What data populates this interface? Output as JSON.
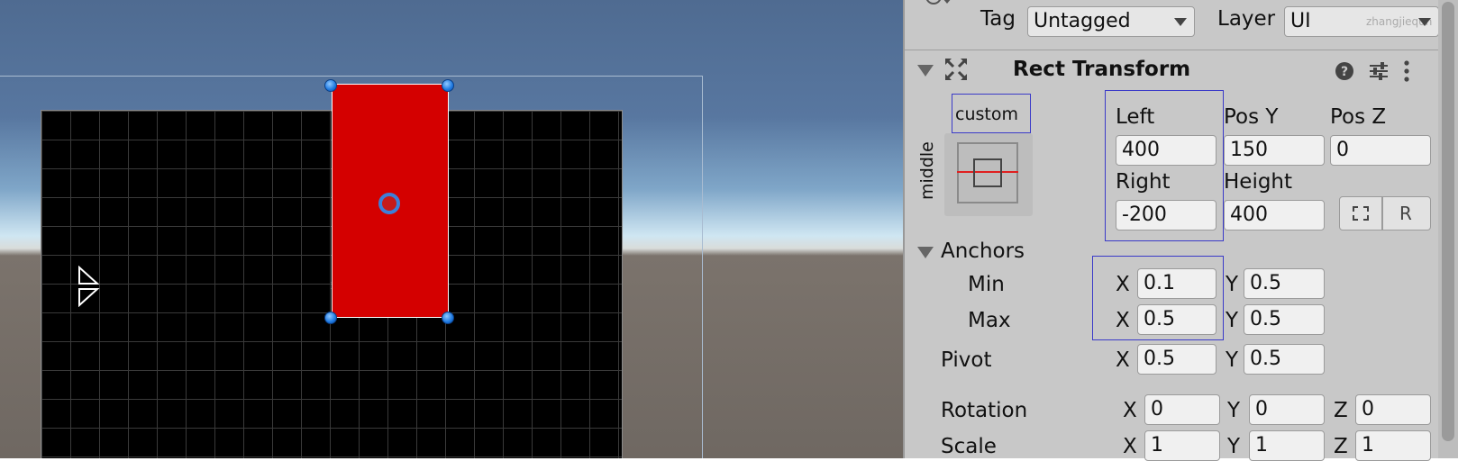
{
  "inspector": {
    "tag_label": "Tag",
    "tag_value": "Untagged",
    "layer_label": "Layer",
    "layer_value": "UI",
    "watermark": "zhangjiequn",
    "component_title": "Rect Transform",
    "anchor_preset": {
      "horizontal": "custom",
      "vertical": "middle"
    },
    "fields": {
      "left_label": "Left",
      "left_value": "400",
      "pos_y_label": "Pos Y",
      "pos_y_value": "150",
      "pos_z_label": "Pos Z",
      "pos_z_value": "0",
      "right_label": "Right",
      "right_value": "-200",
      "height_label": "Height",
      "height_value": "400"
    },
    "anchors": {
      "label": "Anchors",
      "min_label": "Min",
      "min_x": "0.1",
      "min_y": "0.5",
      "max_label": "Max",
      "max_x": "0.5",
      "max_y": "0.5"
    },
    "pivot": {
      "label": "Pivot",
      "x": "0.5",
      "y": "0.5"
    },
    "rotation": {
      "label": "Rotation",
      "x": "0",
      "y": "0",
      "z": "0"
    },
    "scale": {
      "label": "Scale",
      "x": "1",
      "y": "1",
      "z": "1"
    },
    "axis": {
      "x": "X",
      "y": "Y",
      "z": "Z"
    }
  },
  "colors": {
    "selected_rect": "#d40000",
    "handle": "#1d78e0",
    "inspector_bg": "#c8c8c8"
  },
  "icons": [
    "help-icon",
    "settings-sliders-icon",
    "more-vert-icon",
    "rect-transform-icon",
    "blueprint-mode-icon",
    "raw-edit-icon"
  ]
}
